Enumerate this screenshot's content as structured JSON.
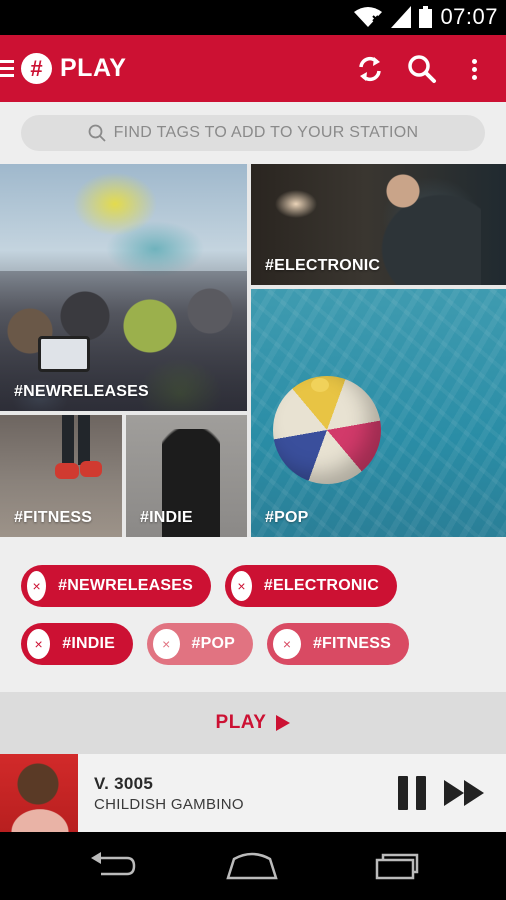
{
  "status_bar": {
    "time": "07:07"
  },
  "app_bar": {
    "logo_glyph": "#",
    "title": "PLAY"
  },
  "search": {
    "placeholder": "FIND TAGS TO ADD TO YOUR STATION"
  },
  "tiles": [
    {
      "tag": "#NEWRELEASES"
    },
    {
      "tag": "#ELECTRONIC"
    },
    {
      "tag": "#POP"
    },
    {
      "tag": "#FITNESS"
    },
    {
      "tag": "#INDIE"
    }
  ],
  "selected_tags": [
    {
      "label": "#NEWRELEASES",
      "remove_glyph": "×"
    },
    {
      "label": "#ELECTRONIC",
      "remove_glyph": "×"
    },
    {
      "label": "#INDIE",
      "remove_glyph": "×"
    },
    {
      "label": "#POP",
      "remove_glyph": "×"
    },
    {
      "label": "#FITNESS",
      "remove_glyph": "×"
    }
  ],
  "play_bar": {
    "label": "PLAY"
  },
  "now_playing": {
    "track": "V. 3005",
    "artist": "CHILDISH GAMBINO"
  },
  "colors": {
    "brand": "#cc1133",
    "chip_light": "#e17381",
    "chip_mid": "#d94a63",
    "background": "#eeeeee"
  },
  "icons": [
    "menu-icon",
    "refresh-icon",
    "search-icon",
    "more-vert-icon",
    "remove-icon",
    "play-icon",
    "pause-icon",
    "fast-forward-icon",
    "back-icon",
    "home-icon",
    "recent-apps-icon",
    "wifi-icon",
    "signal-icon",
    "battery-icon"
  ]
}
